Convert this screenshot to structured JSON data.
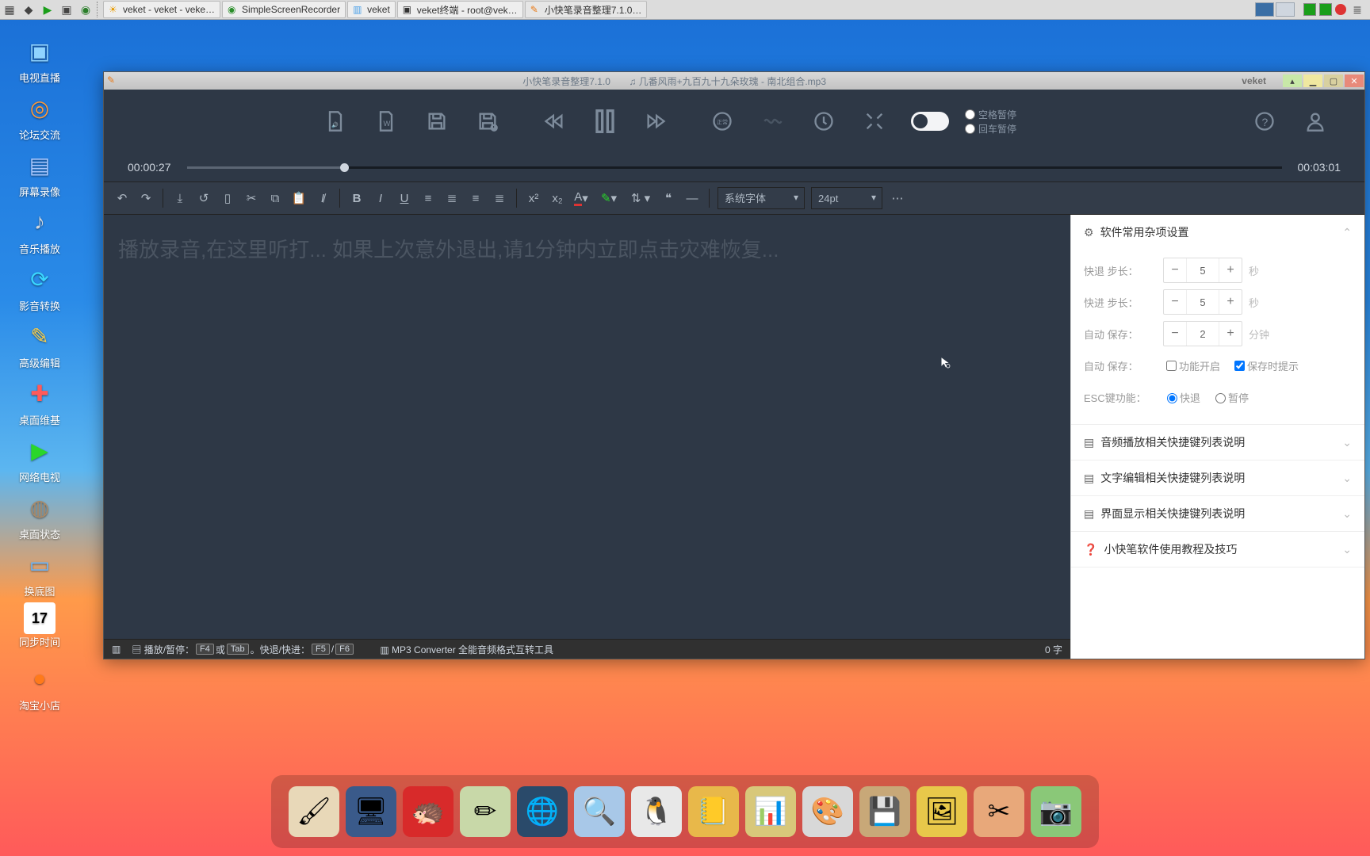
{
  "taskbar": {
    "buttons": [
      {
        "label": "veket - veket - veke…"
      },
      {
        "label": "SimpleScreenRecorder"
      },
      {
        "label": "veket"
      },
      {
        "label": "veket终端 - root@vek…"
      },
      {
        "label": "小快笔录音整理7.1.0…"
      }
    ]
  },
  "desktop_icons": [
    {
      "label": "电视直播",
      "glyph": "▣"
    },
    {
      "label": "论坛交流",
      "glyph": "◎"
    },
    {
      "label": "屏幕录像",
      "glyph": "▤"
    },
    {
      "label": "音乐播放",
      "glyph": "♪"
    },
    {
      "label": "影音转换",
      "glyph": "⟳"
    },
    {
      "label": "高级编辑",
      "glyph": "✎"
    },
    {
      "label": "桌面维基",
      "glyph": "✚"
    },
    {
      "label": "网络电视",
      "glyph": "▶"
    },
    {
      "label": "桌面状态",
      "glyph": "◍"
    },
    {
      "label": "换底图",
      "glyph": "▭"
    },
    {
      "label": "同步时间",
      "glyph": "17"
    },
    {
      "label": "淘宝小店",
      "glyph": "●"
    }
  ],
  "window": {
    "title_left": "小快笔录音整理7.1.0",
    "title_track": "♫ 几番风雨+九百九十九朵玫瑰 - 南北组合.mp3",
    "brand": "veket"
  },
  "player": {
    "time_current": "00:00:27",
    "time_total": "00:03:01",
    "pause_options": {
      "space": "空格暂停",
      "enter": "回车暂停"
    }
  },
  "editor": {
    "placeholder": "播放录音,在这里听打... 如果上次意外退出,请1分钟内立即点击灾难恢复...",
    "font_family": "系统字体",
    "font_size": "24pt",
    "word_count": "0 字"
  },
  "statusbar": {
    "play_pause": "播放/暂停：",
    "or": "或",
    "rewind": "。快退/快进：",
    "sep": "/",
    "mp3": "MP3 Converter 全能音频格式互转工具"
  },
  "sidepanel": {
    "sections": {
      "settings": {
        "title": "软件常用杂项设置"
      },
      "audio_keys": {
        "title": "音频播放相关快捷键列表说明"
      },
      "text_keys": {
        "title": "文字编辑相关快捷键列表说明"
      },
      "ui_keys": {
        "title": "界面显示相关快捷键列表说明"
      },
      "tips": {
        "title": "小快笔软件使用教程及技巧"
      }
    },
    "settings": {
      "rewind_step": {
        "label": "快退  步长：",
        "value": "5",
        "unit": "秒"
      },
      "forward_step": {
        "label": "快进  步长：",
        "value": "5",
        "unit": "秒"
      },
      "autosave_interval": {
        "label": "自动  保存：",
        "value": "2",
        "unit": "分钟"
      },
      "autosave_toggle": {
        "label": "自动  保存：",
        "enable": "功能开启",
        "prompt": "保存时提示"
      },
      "esc": {
        "label": "ESC键功能：",
        "opt1": "快退",
        "opt2": "暂停"
      }
    }
  },
  "keys": {
    "f4": "F4",
    "tab": "Tab",
    "f5": "F5",
    "f6": "F6"
  }
}
